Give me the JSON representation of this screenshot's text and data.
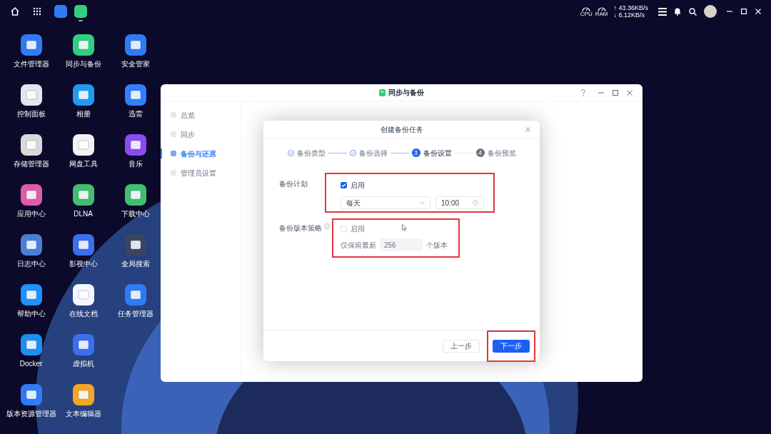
{
  "taskbar": {
    "apps": [
      {
        "color": "#2f7bf6",
        "selected": false
      },
      {
        "color": "#2fcf7f",
        "selected": true
      }
    ]
  },
  "system_tray": {
    "cpu_label": "CPU",
    "ram_label": "RAM",
    "upload": "↑ 43.36KB/s",
    "download": "↓ 6.12KB/s"
  },
  "desktop_apps": [
    {
      "label": "文件管理器",
      "color": "#2f7bf6"
    },
    {
      "label": "控制面板",
      "color": "#e5e5ea"
    },
    {
      "label": "存储管理器",
      "color": "#d9d9d9"
    },
    {
      "label": "应用中心",
      "color": "#e05ba8"
    },
    {
      "label": "日志中心",
      "color": "#4a7fd6"
    },
    {
      "label": "帮助中心",
      "color": "#1e90ff"
    },
    {
      "label": "Docker",
      "color": "#1d8ff0"
    },
    {
      "label": "版本资源管理器",
      "color": "#2f7bf6"
    },
    {
      "label": "同步与备份",
      "color": "#2fcf7f"
    },
    {
      "label": "相册",
      "color": "#1e9bf0"
    },
    {
      "label": "网盘工具",
      "color": "#f2f2f2"
    },
    {
      "label": "DLNA",
      "color": "#3fbf6f"
    },
    {
      "label": "影视中心",
      "color": "#3b6ef0"
    },
    {
      "label": "在线文档",
      "color": "#f4f7ff"
    },
    {
      "label": "虚拟机",
      "color": "#3b6ef0"
    },
    {
      "label": "文本编辑器",
      "color": "#f5a623"
    },
    {
      "label": "安全管家",
      "color": "#2f7bf6"
    },
    {
      "label": "迅雷",
      "color": "#2f80ff"
    },
    {
      "label": "音乐",
      "color": "#8a4bef"
    },
    {
      "label": "下载中心",
      "color": "#3fbf6f"
    },
    {
      "label": "全局搜索",
      "color": "#3a4660"
    },
    {
      "label": "任务管理器",
      "color": "#2f7bf6"
    }
  ],
  "window": {
    "title": "同步与备份",
    "sidebar": [
      {
        "label": "总览",
        "selected": false
      },
      {
        "label": "同步",
        "selected": false
      },
      {
        "label": "备份与还原",
        "selected": true
      },
      {
        "label": "管理员设置",
        "selected": false
      }
    ],
    "dialog": {
      "title": "创建备份任务",
      "steps": [
        {
          "label": "备份类型",
          "completed": true,
          "selected": false
        },
        {
          "label": "备份选择",
          "completed": true,
          "selected": false
        },
        {
          "number": "3",
          "label": "备份设置",
          "completed": false,
          "selected": true
        },
        {
          "number": "4",
          "label": "备份预览",
          "completed": false,
          "selected": false
        }
      ],
      "schedule": {
        "label": "备份计划",
        "enable_label": "启用",
        "enabled": true,
        "frequency": "每天",
        "time": "10:00"
      },
      "version_policy": {
        "label": "备份版本策略",
        "enable_label": "启用",
        "enabled": false,
        "keep_label": "仅保留最新",
        "keep_value": "256",
        "unit": "个版本"
      },
      "back_button": "上一步",
      "next_button": "下一步"
    }
  }
}
